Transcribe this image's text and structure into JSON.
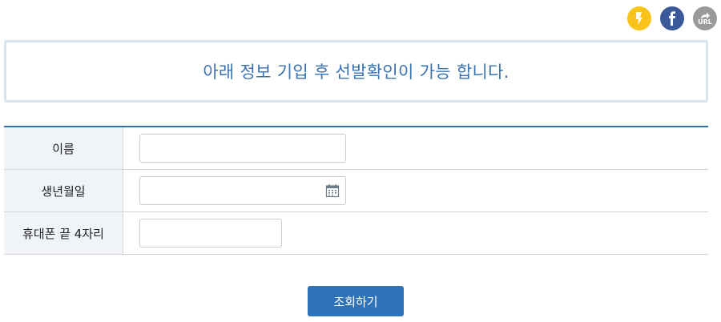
{
  "share": {
    "kakao_icon": "kakaostory-icon",
    "facebook_icon": "facebook-icon",
    "url_icon": "share-url-icon",
    "url_label": "URL",
    "colors": {
      "kakao": "#f9c31a",
      "facebook": "#3b5998",
      "url": "#9a9a9a"
    }
  },
  "notice": {
    "text": "아래 정보 기입 후 선발확인이 가능 합니다."
  },
  "form": {
    "rows": [
      {
        "label": "이름",
        "placeholder": ""
      },
      {
        "label": "생년월일",
        "placeholder": "",
        "icon": "calendar-icon"
      },
      {
        "label": "휴대폰 끝 4자리",
        "placeholder": ""
      }
    ]
  },
  "submit": {
    "label": "조회하기"
  },
  "colors": {
    "accent": "#2f73b9",
    "notice_text": "#3a72b2",
    "header_bg": "#f0f4f8"
  }
}
